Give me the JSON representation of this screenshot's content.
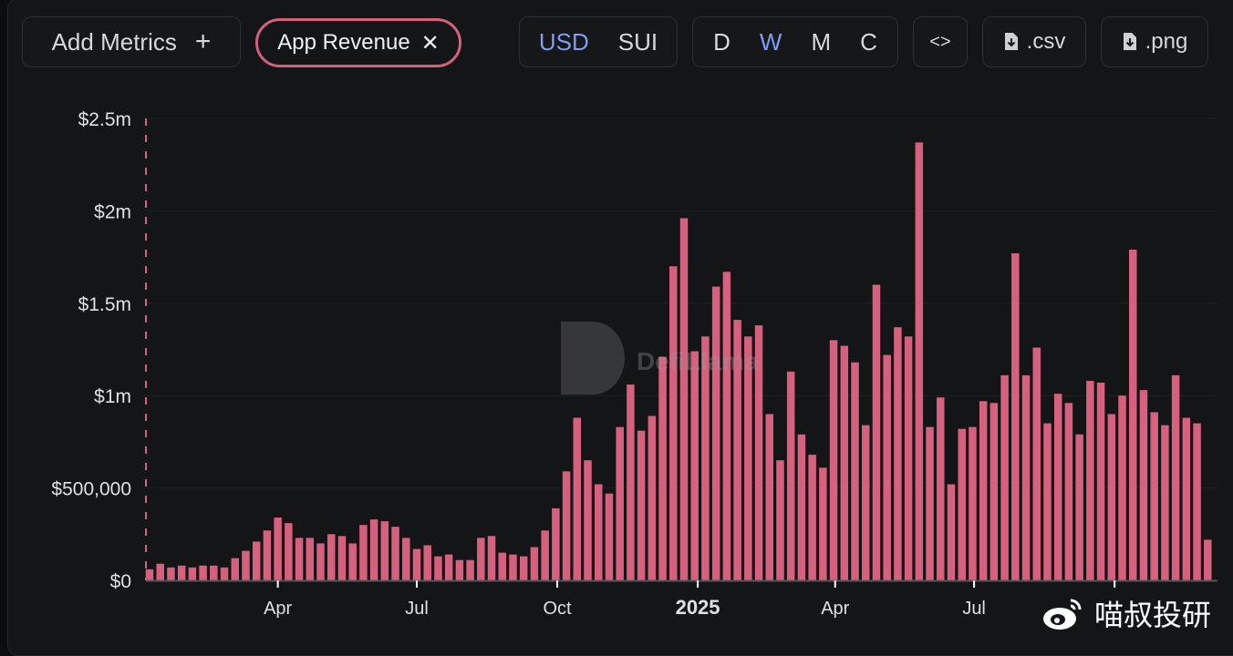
{
  "toolbar": {
    "add_metrics": "Add Metrics",
    "add_icon": "+",
    "metric_pill": "App Revenue",
    "close_icon": "✕",
    "currency": [
      "USD",
      "SUI"
    ],
    "currency_active": "USD",
    "periods": [
      "D",
      "W",
      "M",
      "C"
    ],
    "period_active": "W",
    "embed_icon": "<>",
    "csv": ".csv",
    "png": ".png"
  },
  "watermark": {
    "text": "喵叔投研",
    "logo": "DefiLlama"
  },
  "colors": {
    "bar": "#d5617f",
    "active": "#7f9cf0",
    "background": "#141517"
  },
  "chart_data": {
    "type": "bar",
    "title": "App Revenue",
    "series": [
      {
        "name": "App Revenue",
        "unit": "USD",
        "start": "2024-01-08",
        "interval": "week",
        "values": [
          60000,
          90000,
          70000,
          80000,
          70000,
          80000,
          80000,
          70000,
          120000,
          160000,
          210000,
          270000,
          340000,
          310000,
          230000,
          230000,
          200000,
          250000,
          240000,
          200000,
          300000,
          330000,
          320000,
          290000,
          230000,
          170000,
          190000,
          130000,
          140000,
          110000,
          110000,
          230000,
          240000,
          150000,
          140000,
          130000,
          180000,
          270000,
          390000,
          590000,
          880000,
          650000,
          520000,
          470000,
          830000,
          1060000,
          810000,
          890000,
          1210000,
          1700000,
          1960000,
          1240000,
          1320000,
          1590000,
          1670000,
          1410000,
          1320000,
          1380000,
          900000,
          650000,
          1130000,
          790000,
          680000,
          610000,
          1300000,
          1270000,
          1180000,
          840000,
          1600000,
          1220000,
          1370000,
          1320000,
          2370000,
          830000,
          990000,
          520000,
          820000,
          830000,
          970000,
          960000,
          1110000,
          1770000,
          1110000,
          1260000,
          850000,
          1010000,
          960000,
          790000,
          1080000,
          1070000,
          900000,
          1000000,
          1790000,
          1030000,
          910000,
          840000,
          1110000,
          880000,
          850000,
          220000
        ]
      }
    ],
    "yticks": [
      {
        "value": 0,
        "label": "$0"
      },
      {
        "value": 500000,
        "label": "$500,000"
      },
      {
        "value": 1000000,
        "label": "$1m"
      },
      {
        "value": 1500000,
        "label": "$1.5m"
      },
      {
        "value": 2000000,
        "label": "$2m"
      },
      {
        "value": 2500000,
        "label": "$2.5m"
      }
    ],
    "xticks": [
      {
        "date": "2024-04-01",
        "label": "Apr",
        "bold": false
      },
      {
        "date": "2024-07-01",
        "label": "Jul",
        "bold": false
      },
      {
        "date": "2024-10-01",
        "label": "Oct",
        "bold": false
      },
      {
        "date": "2025-01-01",
        "label": "2025",
        "bold": true
      },
      {
        "date": "2025-04-01",
        "label": "Apr",
        "bold": false
      },
      {
        "date": "2025-07-01",
        "label": "Jul",
        "bold": false
      },
      {
        "date": "2025-10-01",
        "label": "",
        "bold": false
      }
    ],
    "ylim": [
      0,
      2500000
    ],
    "grid": true,
    "legend": "none"
  }
}
